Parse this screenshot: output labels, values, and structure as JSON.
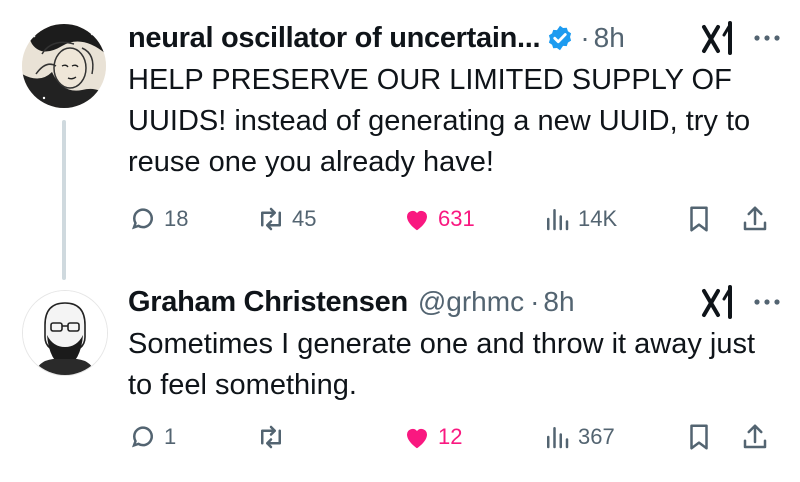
{
  "tweets": [
    {
      "author_name": "neural oscillator of uncertain...",
      "handle": "",
      "dot": "·",
      "time": "8h",
      "verified": true,
      "text": "HELP PRESERVE OUR LIMITED SUPPLY OF UUIDS! instead of generating a new UUID, try to reuse one you already have!",
      "replies": "18",
      "reposts": "45",
      "likes": "631",
      "views": "14K",
      "liked": true
    },
    {
      "author_name": "Graham Christensen",
      "handle": "@grhmc",
      "dot": "·",
      "time": "8h",
      "verified": false,
      "text": "Sometimes I generate one and throw it away just to feel something.",
      "replies": "1",
      "reposts": "",
      "likes": "12",
      "views": "367",
      "liked": true
    }
  ],
  "colors": {
    "text": "#0f1419",
    "secondary": "#536471",
    "like": "#f91880",
    "verified": "#1d9bf0",
    "thread_line": "#cfd9de"
  },
  "icons": [
    "reply-icon",
    "repost-icon",
    "like-icon",
    "views-icon",
    "bookmark-icon",
    "share-icon",
    "grok-icon",
    "more-icon",
    "verified-icon"
  ]
}
